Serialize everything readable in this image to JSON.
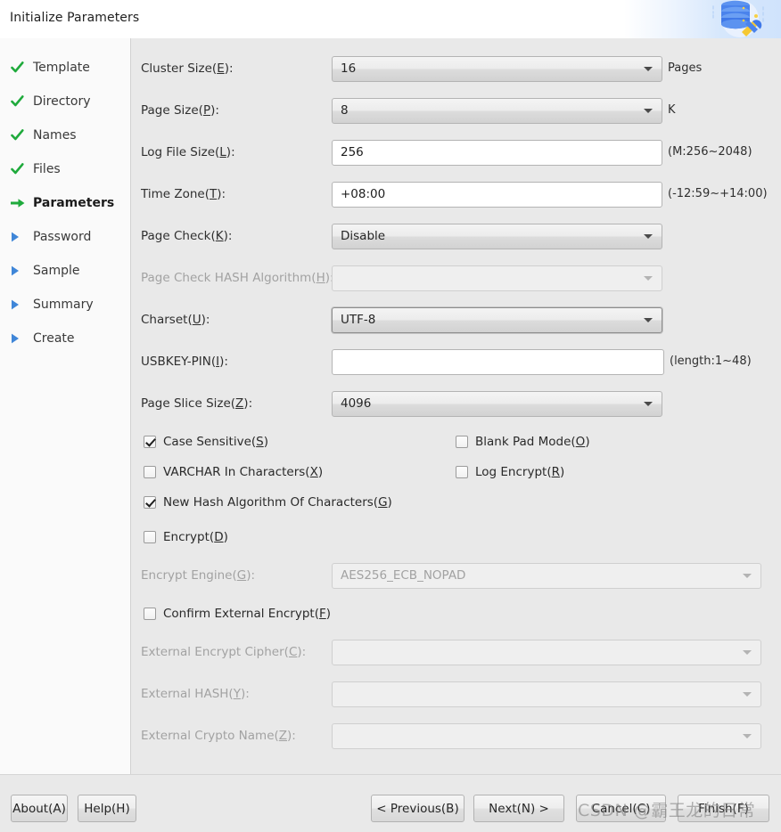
{
  "window": {
    "title": "Initialize Parameters",
    "banner_icon": "database-tools-icon"
  },
  "sidebar": {
    "items": [
      {
        "label": "Template",
        "state": "done",
        "icon": "check-icon"
      },
      {
        "label": "Directory",
        "state": "done",
        "icon": "check-icon"
      },
      {
        "label": "Names",
        "state": "done",
        "icon": "check-icon"
      },
      {
        "label": "Files",
        "state": "done",
        "icon": "check-icon"
      },
      {
        "label": "Parameters",
        "state": "current",
        "icon": "arrow-right-icon"
      },
      {
        "label": "Password",
        "state": "pending",
        "icon": "triangle-right-icon"
      },
      {
        "label": "Sample",
        "state": "pending",
        "icon": "triangle-right-icon"
      },
      {
        "label": "Summary",
        "state": "pending",
        "icon": "triangle-right-icon"
      },
      {
        "label": "Create",
        "state": "pending",
        "icon": "triangle-right-icon"
      }
    ]
  },
  "form": {
    "cluster_size": {
      "label": "Cluster Size(",
      "mnemonic": "E",
      "label_end": "):",
      "value": "16",
      "suffix": "Pages"
    },
    "page_size": {
      "label": "Page Size(",
      "mnemonic": "P",
      "label_end": "):",
      "value": "8",
      "suffix": "K"
    },
    "log_file_size": {
      "label": "Log File Size(",
      "mnemonic": "L",
      "label_end": "):",
      "value": "256",
      "suffix": "(M:256~2048)"
    },
    "time_zone": {
      "label": "Time Zone(",
      "mnemonic": "T",
      "label_end": "):",
      "value": "+08:00",
      "suffix": "(-12:59~+14:00)"
    },
    "page_check": {
      "label": "Page Check(",
      "mnemonic": "K",
      "label_end": "):",
      "value": "Disable",
      "suffix": ""
    },
    "page_check_hash": {
      "label": "Page Check HASH Algorithm(",
      "mnemonic": "H",
      "label_end": "):",
      "value": "",
      "suffix": ""
    },
    "charset": {
      "label": "Charset(",
      "mnemonic": "U",
      "label_end": "):",
      "value": "UTF-8",
      "suffix": ""
    },
    "usbkey_pin": {
      "label": "USBKEY-PIN(",
      "mnemonic": "I",
      "label_end": "):",
      "value": "",
      "suffix": "(length:1~48)"
    },
    "page_slice_size": {
      "label": "Page Slice Size(",
      "mnemonic": "Z",
      "label_end": "):",
      "value": "4096",
      "suffix": ""
    },
    "encrypt_engine": {
      "label": "Encrypt Engine(",
      "mnemonic": "G",
      "label_end": "):",
      "value": "AES256_ECB_NOPAD",
      "suffix": ""
    },
    "ext_encrypt_cipher": {
      "label": "External Encrypt Cipher(",
      "mnemonic": "C",
      "label_end": "):",
      "value": "",
      "suffix": ""
    },
    "ext_hash": {
      "label": "External HASH(",
      "mnemonic": "Y",
      "label_end": "):",
      "value": "",
      "suffix": ""
    },
    "ext_crypto_name": {
      "label": "External Crypto Name(",
      "mnemonic": "Z",
      "label_end": "):",
      "value": "",
      "suffix": ""
    }
  },
  "checkboxes": {
    "case_sensitive": {
      "label": "Case Sensitive(",
      "mnemonic": "S",
      "label_end": ")",
      "checked": true
    },
    "blank_pad_mode": {
      "label": "Blank Pad Mode(",
      "mnemonic": "O",
      "label_end": ")",
      "checked": false
    },
    "varchar_in_chars": {
      "label": "VARCHAR In Characters(",
      "mnemonic": "X",
      "label_end": ")",
      "checked": false
    },
    "log_encrypt": {
      "label": "Log Encrypt(",
      "mnemonic": "R",
      "label_end": ")",
      "checked": false
    },
    "new_hash_algorithm": {
      "label": "New Hash Algorithm Of Characters(",
      "mnemonic": "G",
      "label_end": ")",
      "checked": true
    },
    "encrypt": {
      "label": "Encrypt(",
      "mnemonic": "D",
      "label_end": ")",
      "checked": false
    },
    "confirm_ext_encrypt": {
      "label": "Confirm External Encrypt(",
      "mnemonic": "F",
      "label_end": ")",
      "checked": false
    }
  },
  "footer": {
    "about": "About(A)",
    "help": "Help(H)",
    "previous": "< Previous(B)",
    "next": "Next(N) >",
    "cancel": "Cancel(C)",
    "finish": "Finish(F)"
  },
  "watermark": {
    "text": "CSDN @霸王龙的日常"
  },
  "colors": {
    "accent_green": "#1faa3c",
    "accent_blue": "#3f86d8",
    "content_bg": "#e9e9e9",
    "sidebar_bg": "#fafafa",
    "banner_blue": "#d0e3fc"
  }
}
